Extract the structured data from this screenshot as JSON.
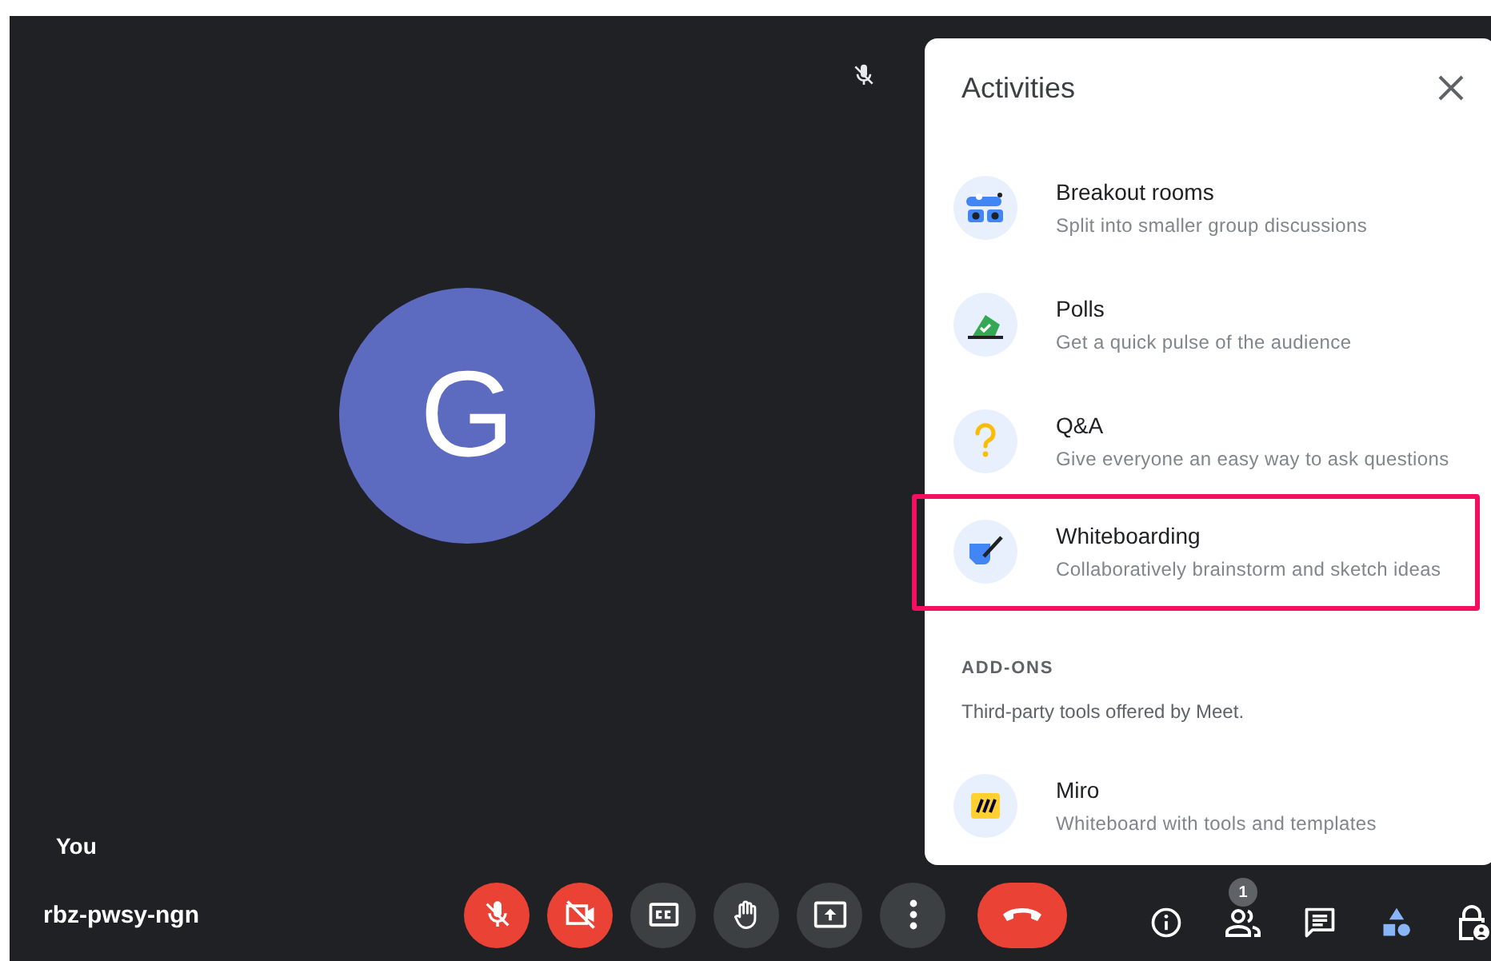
{
  "tile": {
    "avatar_letter": "G",
    "name": "You",
    "muted": true
  },
  "meeting_code": "rbz-pwsy-ngn",
  "controls": [
    {
      "kind": "mic",
      "on": false
    },
    {
      "kind": "camera",
      "on": false
    },
    {
      "kind": "captions"
    },
    {
      "kind": "hand"
    },
    {
      "kind": "present"
    },
    {
      "kind": "more"
    },
    {
      "kind": "hangup"
    }
  ],
  "side_controls": [
    {
      "kind": "info",
      "selected": false
    },
    {
      "kind": "people",
      "selected": false,
      "badge": "1"
    },
    {
      "kind": "chat",
      "selected": false
    },
    {
      "kind": "activities",
      "selected": true
    },
    {
      "kind": "host",
      "selected": false
    }
  ],
  "panel": {
    "title": "Activities",
    "activities": [
      {
        "kind": "breakout",
        "title": "Breakout rooms",
        "subtitle": "Split into smaller group discussions",
        "highlighted": false
      },
      {
        "kind": "polls",
        "title": "Polls",
        "subtitle": "Get a quick pulse of the audience",
        "highlighted": false
      },
      {
        "kind": "qa",
        "title": "Q&A",
        "subtitle": "Give everyone an easy way to ask questions",
        "highlighted": false
      },
      {
        "kind": "whiteboard",
        "title": "Whiteboarding",
        "subtitle": "Collaboratively brainstorm and sketch ideas",
        "highlighted": true
      }
    ],
    "addons": {
      "heading": "ADD-ONS",
      "description": "Third-party tools offered by Meet.",
      "items": [
        {
          "kind": "miro",
          "title": "Miro",
          "subtitle": "Whiteboard with tools and templates",
          "highlighted": false
        }
      ]
    }
  }
}
